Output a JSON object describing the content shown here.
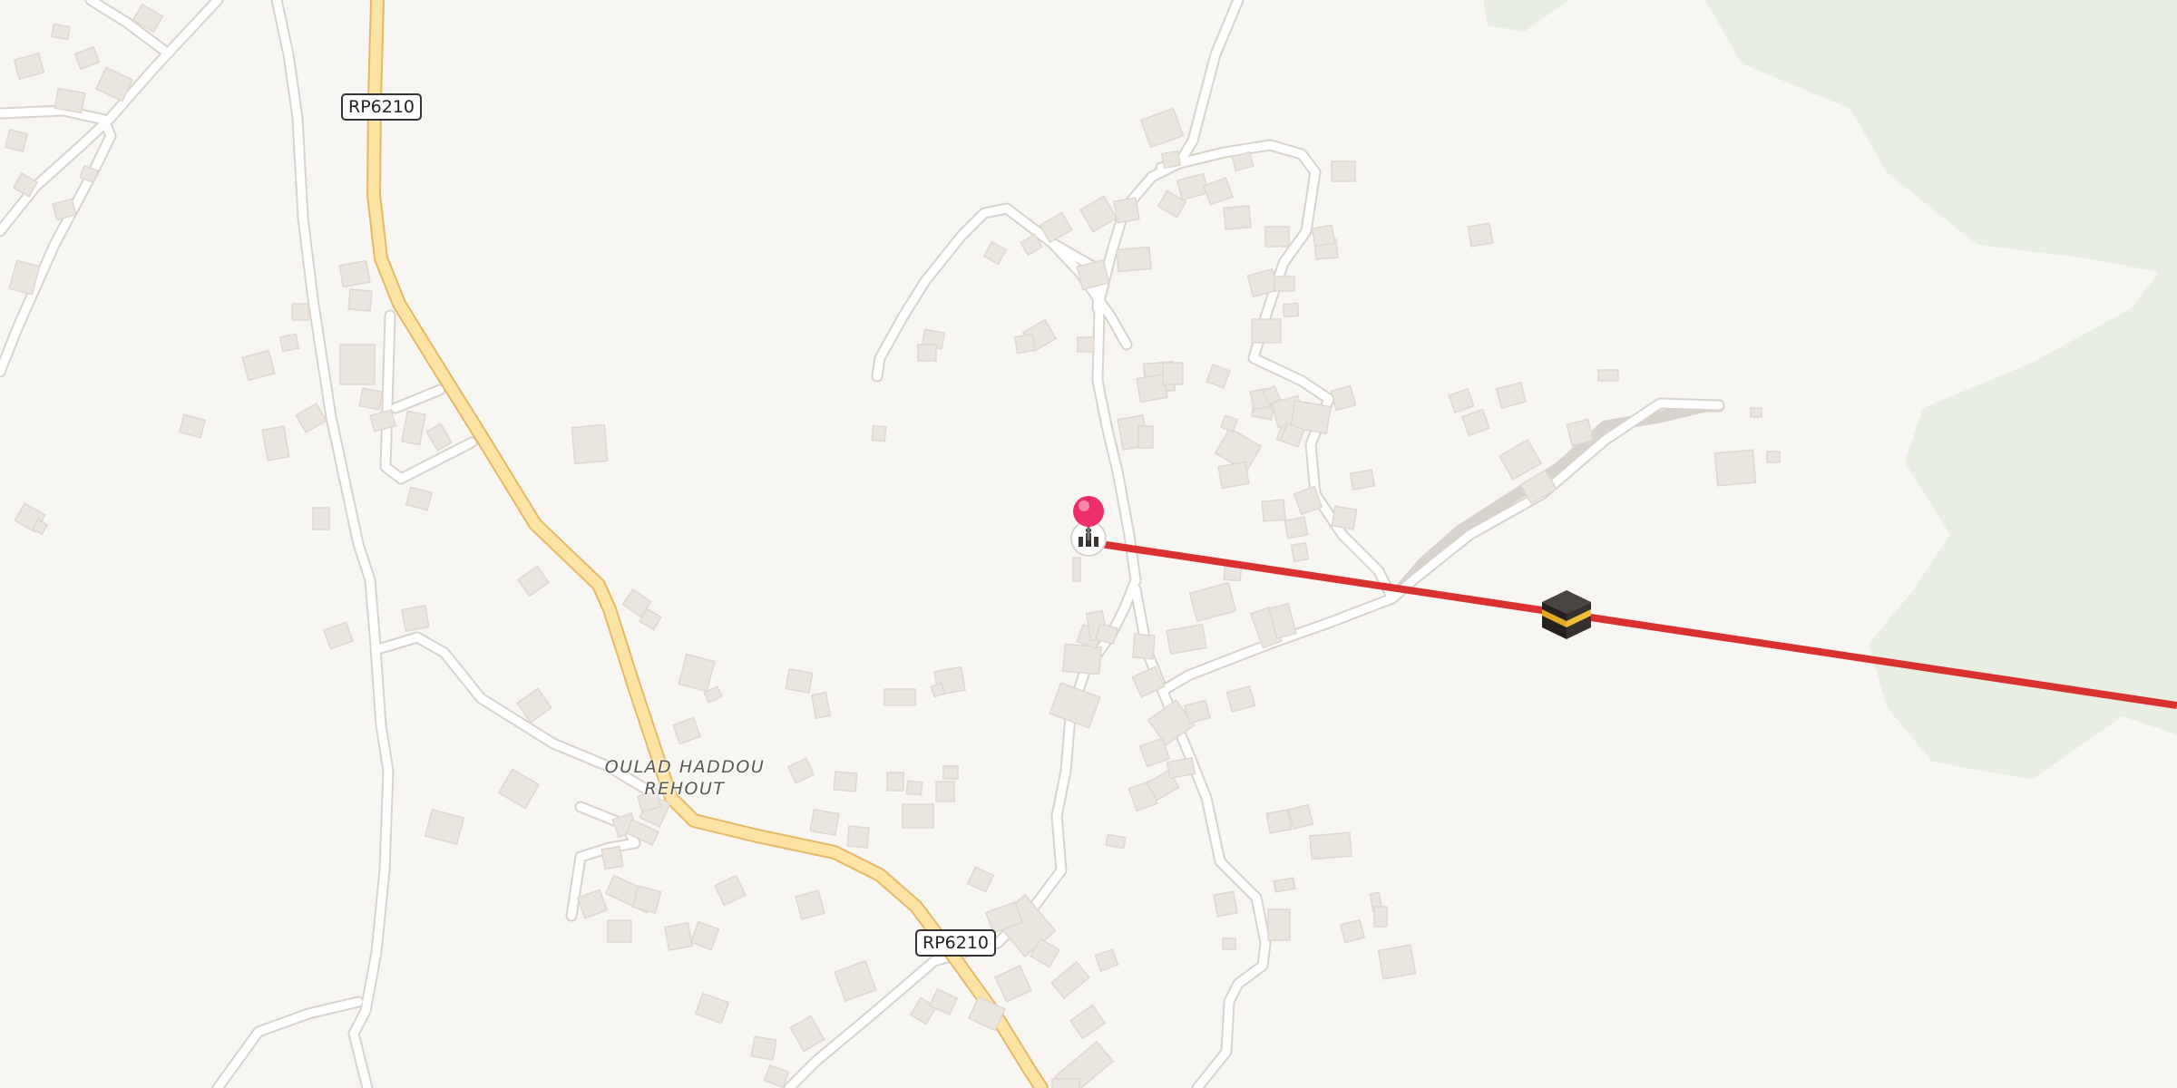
{
  "map": {
    "colors": {
      "background": "#f8f6f2",
      "forest": "#e8efe2",
      "building": "#ebe5df",
      "road": "#ffffff",
      "road_casing": "#d8d3cc",
      "primary_road": "#fde4a4",
      "primary_road_casing": "#e7b868",
      "qibla_line": "#d93030",
      "pin": "#ee2f6a"
    },
    "road_labels": [
      {
        "id": "rp6210-north",
        "text": "RP6210"
      },
      {
        "id": "rp6210-south",
        "text": "RP6210"
      }
    ],
    "place_label": {
      "line1": "OULAD HADDOU",
      "line2": "REHOUT"
    },
    "markers": {
      "location_pin": "location-pin-icon",
      "mosque": "mosque-icon",
      "kaaba": "kaaba-icon"
    }
  }
}
